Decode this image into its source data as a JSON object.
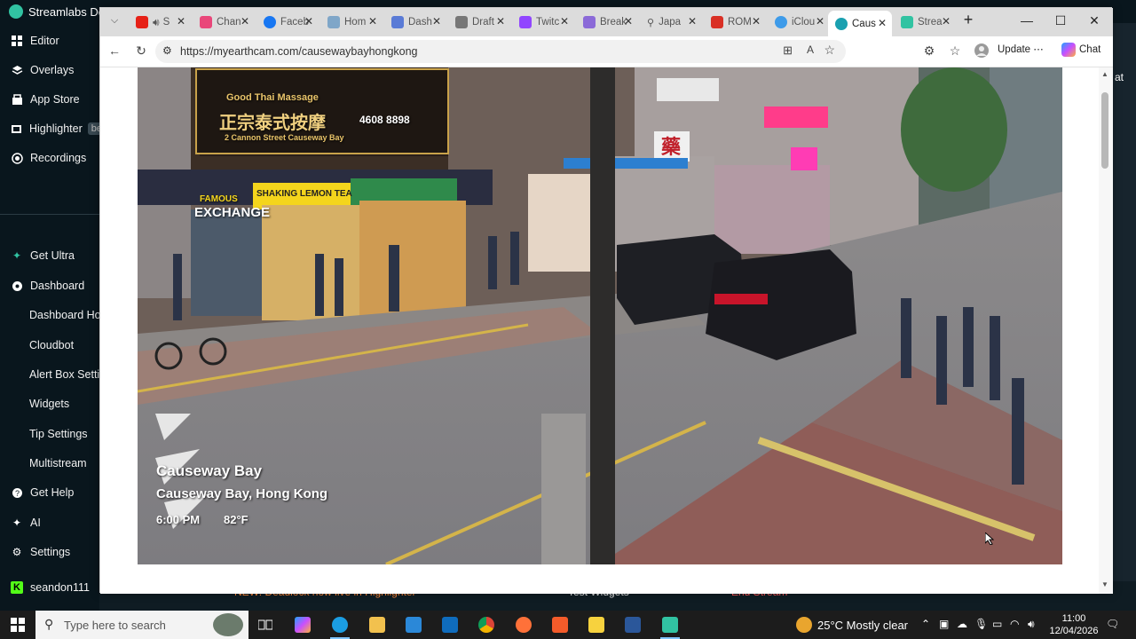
{
  "streamlabs": {
    "title": "Streamlabs De",
    "nav": [
      {
        "label": "Editor",
        "icon": "grid-icon"
      },
      {
        "label": "Overlays",
        "icon": "overlays-icon"
      },
      {
        "label": "App Store",
        "icon": "store-icon"
      },
      {
        "label": "Highlighter",
        "icon": "highlighter-icon",
        "badge": "be"
      },
      {
        "label": "Recordings",
        "icon": "record-icon"
      }
    ],
    "nav2": [
      {
        "label": "Get Ultra",
        "icon": "ultra-icon"
      },
      {
        "label": "Dashboard",
        "icon": "dashboard-icon"
      },
      {
        "label": "Dashboard Hom"
      },
      {
        "label": "Cloudbot"
      },
      {
        "label": "Alert Box Settin"
      },
      {
        "label": "Widgets"
      },
      {
        "label": "Tip Settings"
      },
      {
        "label": "Multistream"
      },
      {
        "label": "Get Help",
        "icon": "help-icon"
      },
      {
        "label": "AI",
        "icon": "ai-icon"
      },
      {
        "label": "Settings",
        "icon": "gear-icon"
      },
      {
        "label": "seandon111",
        "icon": "kick-icon"
      }
    ],
    "right_edge_text": "at",
    "strip": {
      "news": "NEW: Deadlock now live in Highlighter",
      "test_widgets": "Test Widgets",
      "end_stream": "End Stream"
    }
  },
  "browser": {
    "tabs": [
      {
        "title": "S",
        "color": "#e62117"
      },
      {
        "title": "Chan",
        "color": "#e9477a"
      },
      {
        "title": "Faceb",
        "color": "#1877f2"
      },
      {
        "title": "Hom",
        "color": "#7fa6c8"
      },
      {
        "title": "Dash",
        "color": "#5a7bd6"
      },
      {
        "title": "Draft",
        "color": "#777777"
      },
      {
        "title": "Twitc",
        "color": "#9146ff"
      },
      {
        "title": "Break",
        "color": "#8b6ad8"
      },
      {
        "title": "Japa",
        "color": "#666666"
      },
      {
        "title": "ROM",
        "color": "#d93025"
      },
      {
        "title": "iClou",
        "color": "#3e9be9"
      },
      {
        "title": "Caus",
        "color": "#1aa0b0",
        "active": true
      },
      {
        "title": "Strea",
        "color": "#31c3a2"
      }
    ],
    "url": "https://myearthcam.com/causewaybayhongkong",
    "update_label": "Update",
    "chat_label": "Chat"
  },
  "webcam": {
    "location_title": "Causeway Bay",
    "location_sub": "Causeway Bay, Hong Kong",
    "time": "6:00 PM",
    "temp": "82°F",
    "signs": {
      "massage_en": "Good Thai Massage",
      "massage_zh": "正宗泰式按摩",
      "massage_addr": "2 Cannon Street Causeway Bay",
      "phone": "4608 8898",
      "exchange_top": "FAMOUS",
      "exchange": "EXCHANGE",
      "lemon_tea": "SHAKING LEMON TEA",
      "pharmacy": "藥"
    }
  },
  "taskbar": {
    "search_placeholder": "Type here to search",
    "weather": "25°C  Mostly clear",
    "time": "11:00",
    "date": "12/04/2026"
  }
}
